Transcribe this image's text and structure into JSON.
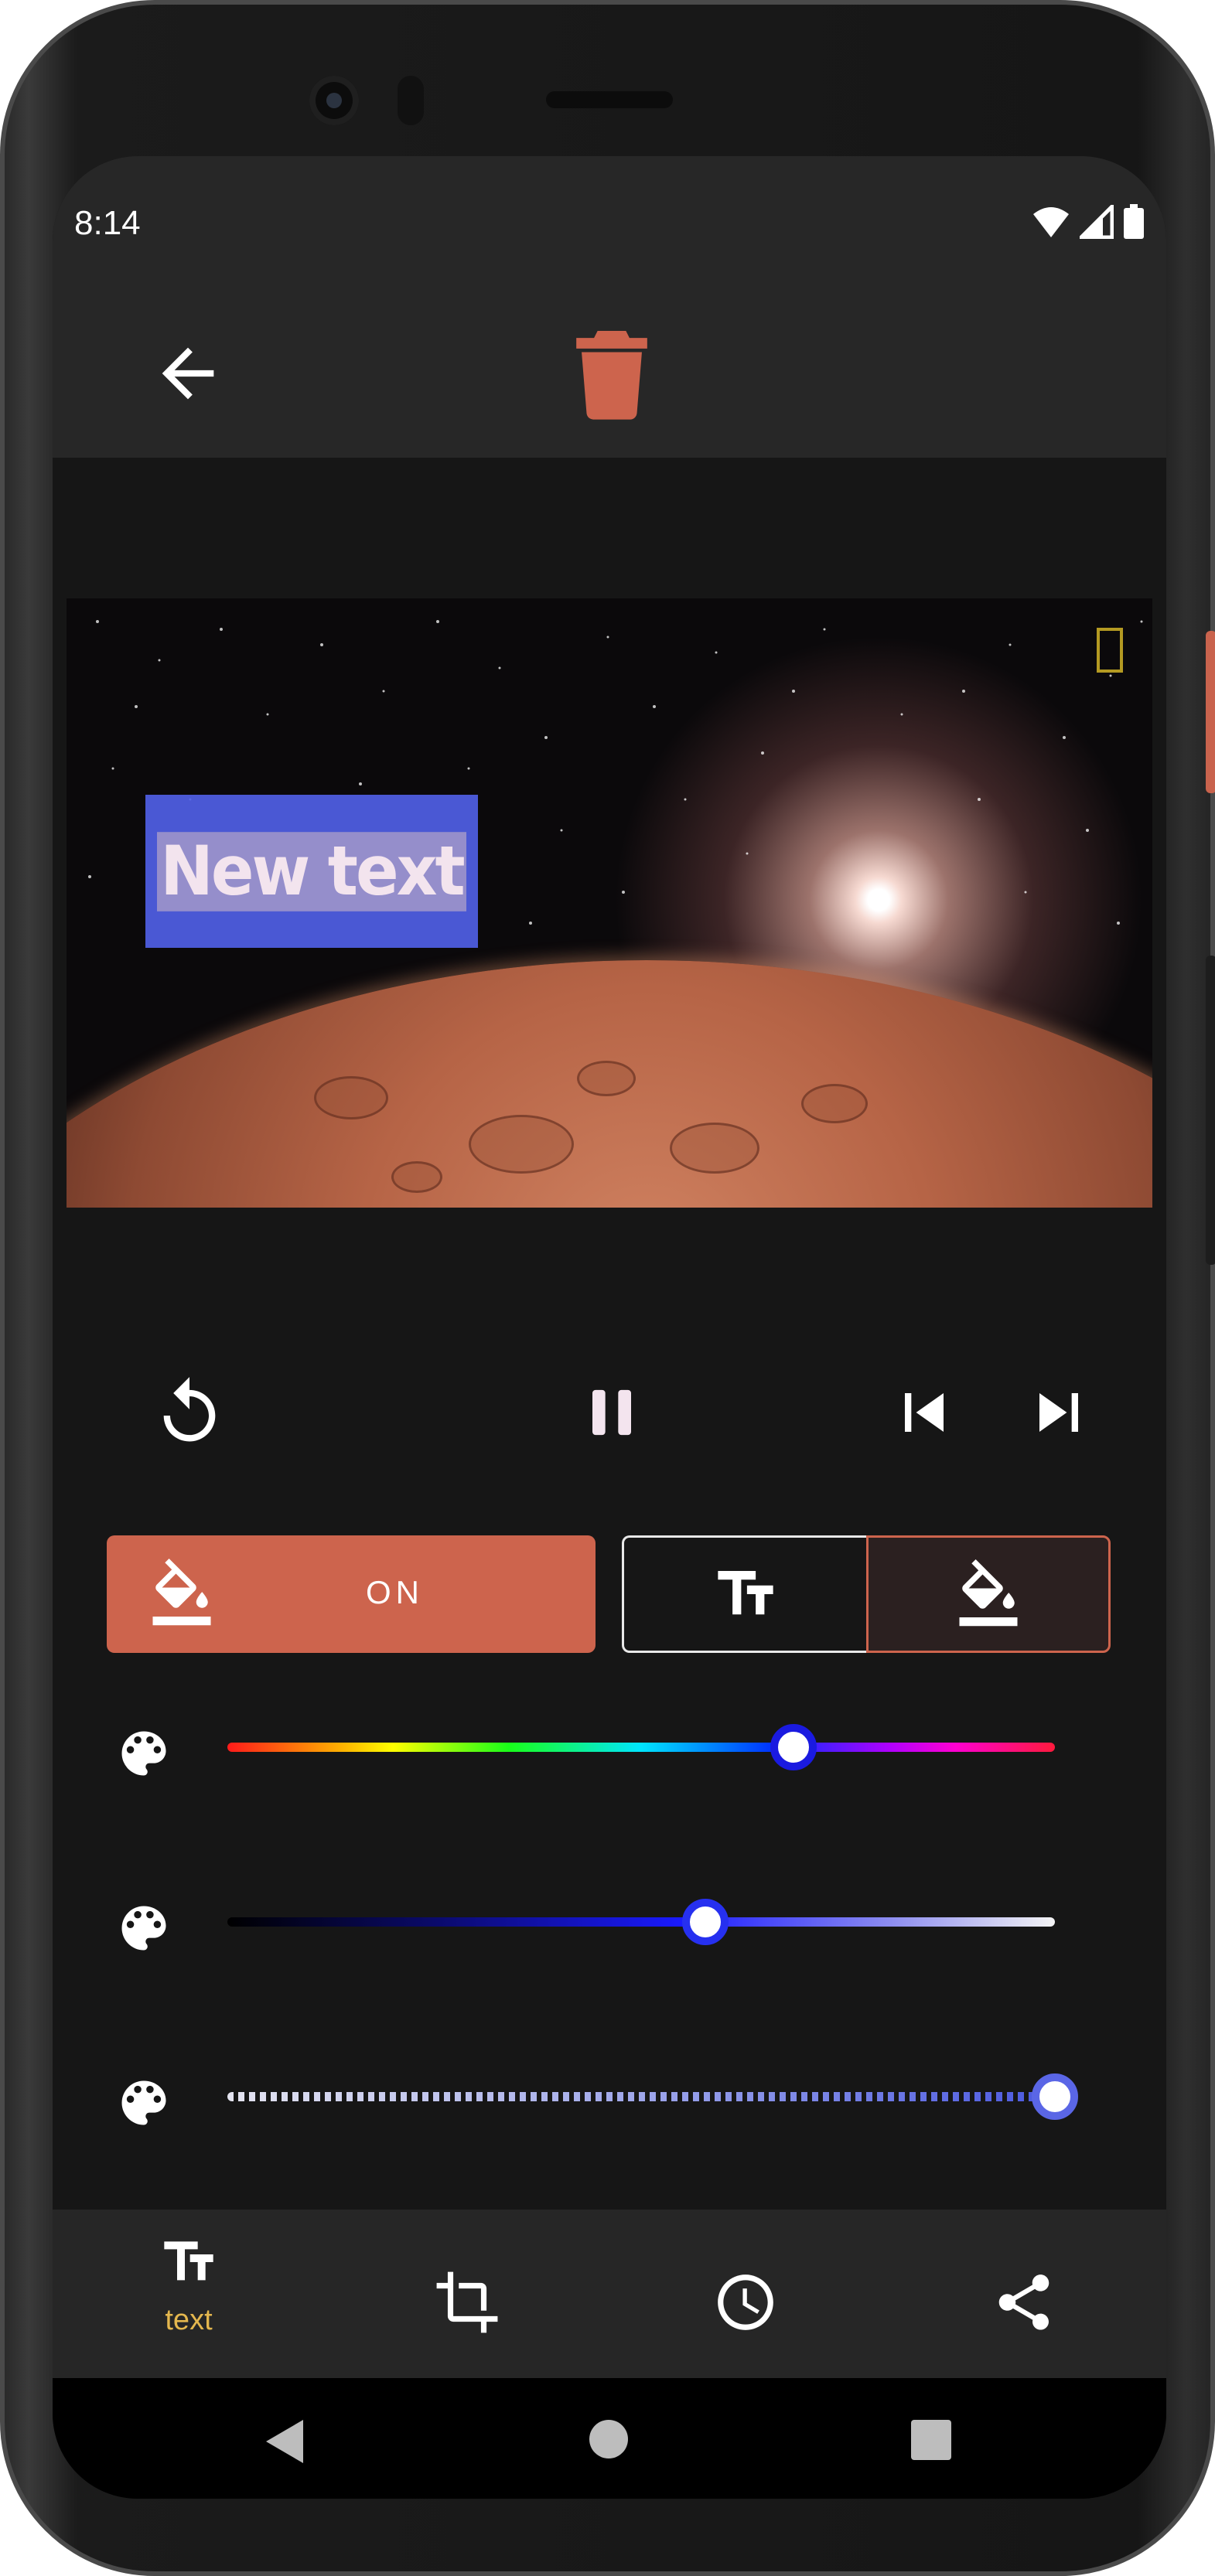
{
  "status_bar": {
    "time": "8:14",
    "icons": [
      "wifi-icon",
      "signal-icon",
      "battery-icon"
    ]
  },
  "app_bar": {
    "back_icon": "arrow-back-icon",
    "delete_icon": "trash-icon",
    "accent": "#cd644d"
  },
  "video_preview": {
    "overlay_text": "New text",
    "overlay_box_color": "#505fe6"
  },
  "playback": {
    "icons": [
      "replay-icon",
      "pause-icon",
      "skip-previous-icon",
      "skip-next-icon"
    ]
  },
  "style_toggle": {
    "label": "ON",
    "icon": "format-color-fill-icon"
  },
  "segments": [
    {
      "icon": "text-size-icon"
    },
    {
      "icon": "format-color-fill-icon",
      "selected": true
    }
  ],
  "sliders": [
    {
      "icon": "palette-icon",
      "kind": "hue",
      "value": 0.67,
      "thumb_border": "#1a1ae0"
    },
    {
      "icon": "palette-icon",
      "kind": "brightness",
      "value": 0.55,
      "thumb_border": "#2630f0"
    },
    {
      "icon": "palette-icon",
      "kind": "opacity",
      "value": 1.0,
      "thumb_border": "#5a66e6"
    }
  ],
  "bottom_nav": {
    "items": [
      {
        "icon": "text-size-icon",
        "label": "text",
        "active": true
      },
      {
        "icon": "crop-icon",
        "label": ""
      },
      {
        "icon": "clock-icon",
        "label": ""
      },
      {
        "icon": "share-icon",
        "label": ""
      }
    ],
    "active_color": "#e4b74e"
  },
  "system_nav": {
    "icons": [
      "back-triangle-icon",
      "home-circle-icon",
      "recents-square-icon"
    ]
  }
}
